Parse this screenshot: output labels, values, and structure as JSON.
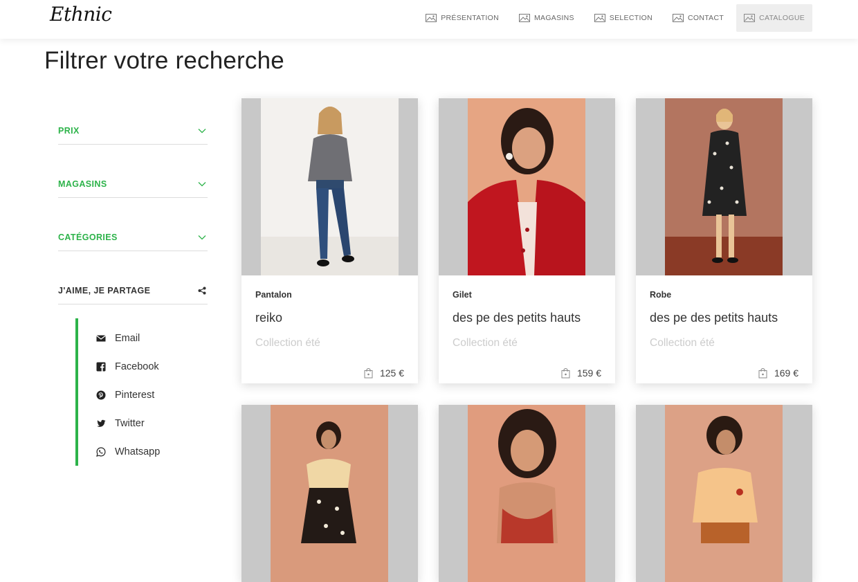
{
  "brand": {
    "logo": "Ethnic"
  },
  "nav": {
    "items": [
      {
        "label": "PRÉSENTATION",
        "active": false
      },
      {
        "label": "MAGASINS",
        "active": false
      },
      {
        "label": "SELECTION",
        "active": false
      },
      {
        "label": "CONTACT",
        "active": false
      },
      {
        "label": "CATALOGUE",
        "active": true
      }
    ]
  },
  "page": {
    "title": "Filtrer votre recherche"
  },
  "filters": [
    {
      "label": "PRIX",
      "icon": "chevron-down-icon"
    },
    {
      "label": "MAGASINS",
      "icon": "chevron-down-icon"
    },
    {
      "label": "CATÉGORIES",
      "icon": "chevron-down-icon"
    },
    {
      "label": "J'AIME, JE PARTAGE",
      "icon": "share-icon"
    }
  ],
  "share": [
    {
      "label": "Email",
      "icon": "envelope-icon"
    },
    {
      "label": "Facebook",
      "icon": "facebook-icon"
    },
    {
      "label": "Pinterest",
      "icon": "pinterest-icon"
    },
    {
      "label": "Twitter",
      "icon": "twitter-icon"
    },
    {
      "label": "Whatsapp",
      "icon": "whatsapp-icon"
    }
  ],
  "products": [
    {
      "type": "Pantalon",
      "name": "reiko",
      "collection": "Collection été",
      "price": "125 €"
    },
    {
      "type": "Gilet",
      "name": "des pe des petits hauts",
      "collection": "Collection été",
      "price": "159 €"
    },
    {
      "type": "Robe",
      "name": "des pe des petits hauts",
      "collection": "Collection été",
      "price": "169 €"
    },
    {
      "type": "",
      "name": "",
      "collection": "",
      "price": ""
    },
    {
      "type": "",
      "name": "",
      "collection": "",
      "price": ""
    },
    {
      "type": "",
      "name": "",
      "collection": "",
      "price": ""
    }
  ],
  "colors": {
    "accent": "#2db34a",
    "card_placeholder": "#c8c8c8"
  }
}
